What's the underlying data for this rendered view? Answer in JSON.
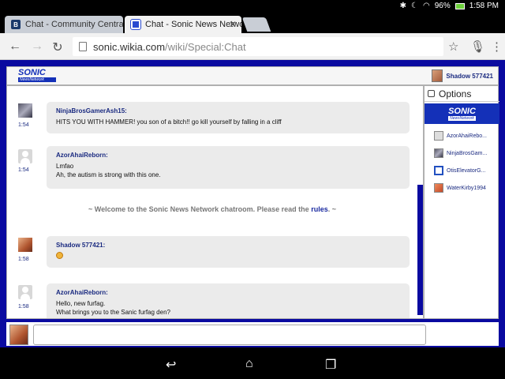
{
  "status": {
    "time": "1:58 PM",
    "battery": "96%"
  },
  "tabs": [
    {
      "label": "Chat - Community Central - V",
      "favicon": "B"
    },
    {
      "label": "Chat - Sonic News Network"
    }
  ],
  "toolbar": {
    "url_host": "sonic.wikia.com",
    "url_path": "/wiki/Special:Chat"
  },
  "header": {
    "logo_top": "SONIC",
    "logo_bottom": "NewsNetwork",
    "self_user": "Shadow 577421"
  },
  "messages": [
    {
      "user": "NinjaBrosGamerAsh15:",
      "time": "1:54",
      "lines": [
        "HITS YOU WITH HAMMER! you son of a bitch!! go kill yourself by falling in a cliff"
      ]
    },
    {
      "user": "AzorAhaiReborn:",
      "time": "1:54",
      "lines": [
        "Lmfao",
        "Ah, the autism is strong with this one."
      ]
    },
    {
      "user": "Shadow 577421:",
      "time": "1:58",
      "lines": []
    },
    {
      "user": "AzorAhaiReborn:",
      "time": "1:58",
      "lines": [
        "Hello, new furfag.",
        "What brings you to the Sanic furfag den?"
      ]
    }
  ],
  "welcome": {
    "prefix": "~ Welcome to the Sonic News Network chatroom. Please read the ",
    "link": "rules",
    "suffix": ". ~"
  },
  "sidebar": {
    "options_label": "Options",
    "logo_top": "SONIC",
    "logo_bottom": "NewsNetwork",
    "users": [
      "AzorAhaiRebo...",
      "NinjaBrosGam...",
      "OtisElevatorG...",
      "WaterKirby1994"
    ]
  },
  "colors": {
    "page_bg": "#0a0aa0",
    "name": "#1a2a80",
    "bubble": "#ebebeb"
  }
}
